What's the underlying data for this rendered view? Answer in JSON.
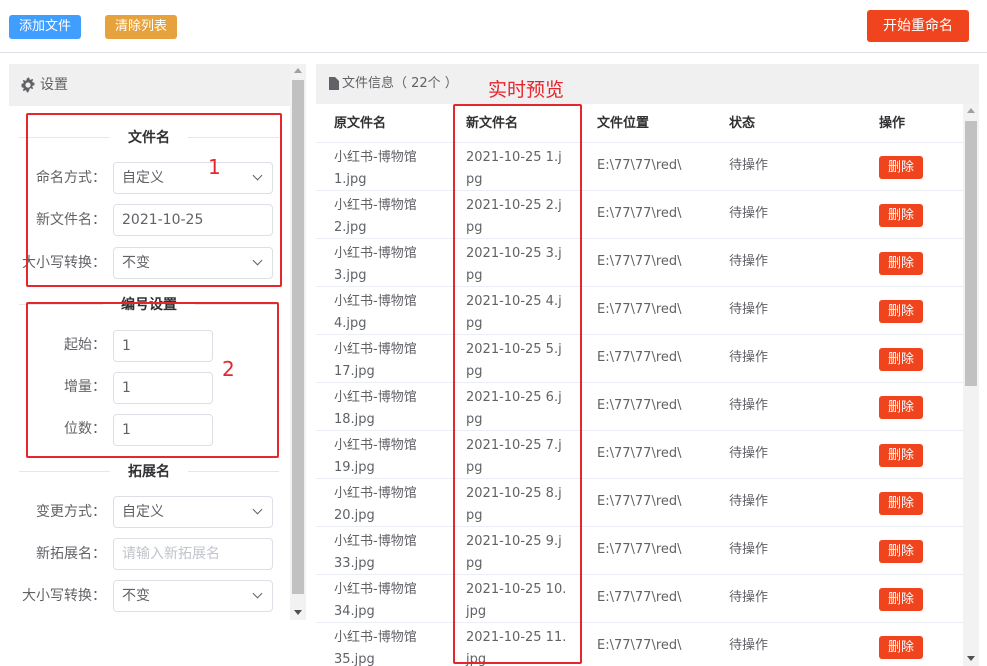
{
  "toolbar": {
    "add_label": "添加文件",
    "clear_label": "清除列表",
    "start_label": "开始重命名"
  },
  "settings": {
    "title": "设置",
    "filename_section": "文件名",
    "naming_mode_label": "命名方式：",
    "naming_mode_value": "自定义",
    "new_name_label": "新文件名：",
    "new_name_value": "2021-10-25",
    "case_label": "大小写转换：",
    "case_value": "不变",
    "numbering_section": "编号设置",
    "start_label": "起始：",
    "start_value": "1",
    "step_label": "增量：",
    "step_value": "1",
    "digits_label": "位数：",
    "digits_value": "1",
    "ext_section": "拓展名",
    "ext_mode_label": "变更方式：",
    "ext_mode_value": "自定义",
    "new_ext_label": "新拓展名：",
    "new_ext_placeholder": "请输入新拓展名",
    "ext_case_label": "大小写转换：",
    "ext_case_value": "不变"
  },
  "annotations": {
    "box1": "1",
    "box2": "2",
    "preview": "实时预览"
  },
  "file_info": {
    "title": "文件信息（ 22个 ）",
    "columns": {
      "original": "原文件名",
      "new": "新文件名",
      "location": "文件位置",
      "status": "状态",
      "action": "操作"
    },
    "rows": [
      {
        "orig1": "小红书-博物馆",
        "orig2": "1.jpg",
        "new1": "2021-10-25 1.j",
        "new2": "pg",
        "loc": "E:\\77\\77\\red\\",
        "status": "待操作",
        "action": "删除"
      },
      {
        "orig1": "小红书-博物馆",
        "orig2": "2.jpg",
        "new1": "2021-10-25 2.j",
        "new2": "pg",
        "loc": "E:\\77\\77\\red\\",
        "status": "待操作",
        "action": "删除"
      },
      {
        "orig1": "小红书-博物馆",
        "orig2": "3.jpg",
        "new1": "2021-10-25 3.j",
        "new2": "pg",
        "loc": "E:\\77\\77\\red\\",
        "status": "待操作",
        "action": "删除"
      },
      {
        "orig1": "小红书-博物馆",
        "orig2": "4.jpg",
        "new1": "2021-10-25 4.j",
        "new2": "pg",
        "loc": "E:\\77\\77\\red\\",
        "status": "待操作",
        "action": "删除"
      },
      {
        "orig1": "小红书-博物馆",
        "orig2": "17.jpg",
        "new1": "2021-10-25 5.j",
        "new2": "pg",
        "loc": "E:\\77\\77\\red\\",
        "status": "待操作",
        "action": "删除"
      },
      {
        "orig1": "小红书-博物馆",
        "orig2": "18.jpg",
        "new1": "2021-10-25 6.j",
        "new2": "pg",
        "loc": "E:\\77\\77\\red\\",
        "status": "待操作",
        "action": "删除"
      },
      {
        "orig1": "小红书-博物馆",
        "orig2": "19.jpg",
        "new1": "2021-10-25 7.j",
        "new2": "pg",
        "loc": "E:\\77\\77\\red\\",
        "status": "待操作",
        "action": "删除"
      },
      {
        "orig1": "小红书-博物馆",
        "orig2": "20.jpg",
        "new1": "2021-10-25 8.j",
        "new2": "pg",
        "loc": "E:\\77\\77\\red\\",
        "status": "待操作",
        "action": "删除"
      },
      {
        "orig1": "小红书-博物馆",
        "orig2": "33.jpg",
        "new1": "2021-10-25 9.j",
        "new2": "pg",
        "loc": "E:\\77\\77\\red\\",
        "status": "待操作",
        "action": "删除"
      },
      {
        "orig1": "小红书-博物馆",
        "orig2": "34.jpg",
        "new1": "2021-10-25 10.",
        "new2": "jpg",
        "loc": "E:\\77\\77\\red\\",
        "status": "待操作",
        "action": "删除"
      },
      {
        "orig1": "小红书-博物馆",
        "orig2": "35.jpg",
        "new1": "2021-10-25 11.",
        "new2": "jpg",
        "loc": "E:\\77\\77\\red\\",
        "status": "待操作",
        "action": "删除"
      }
    ]
  },
  "colors": {
    "primary": "#409eff",
    "warning": "#e6a23c",
    "danger": "#f0441e",
    "annotation_red": "#e5262d"
  }
}
